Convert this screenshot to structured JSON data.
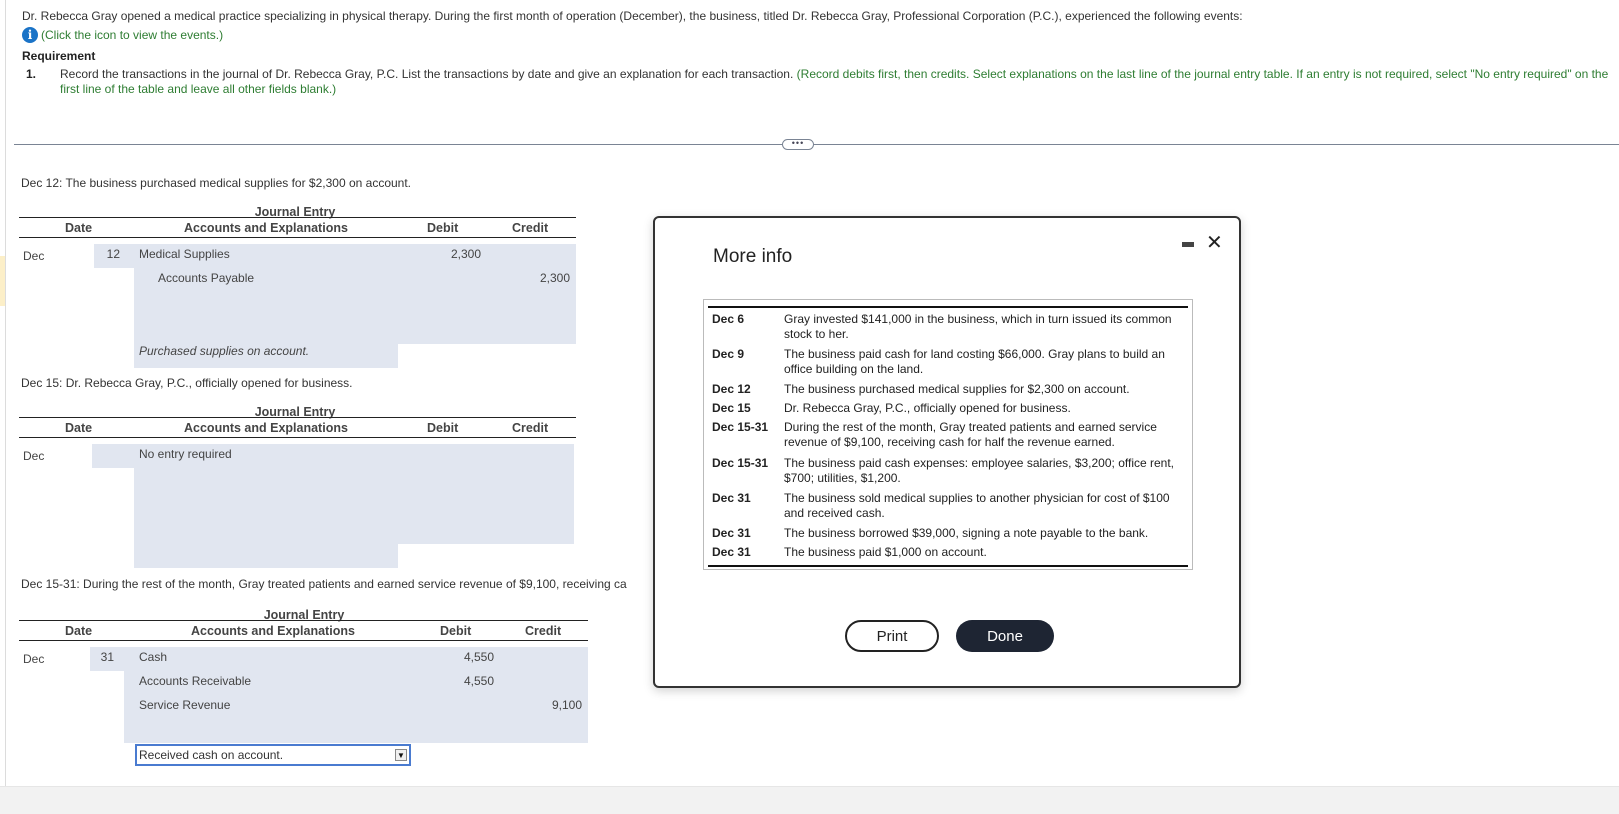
{
  "intro": {
    "text": "Dr. Rebecca Gray opened a medical practice specializing in physical therapy. During the first month of operation (December), the business, titled Dr. Rebecca Gray, Professional Corporation (P.C.), experienced the following events:",
    "hint": "(Click the icon to view the events.)",
    "info_icon": "info-icon"
  },
  "requirement": {
    "title": "Requirement",
    "number": "1.",
    "text": "Record the transactions in the journal of Dr. Rebecca Gray, P.C. List the transactions by date and give an explanation for each transaction.",
    "instruction": "(Record debits first, then credits. Select explanations on the last line of the journal entry table. If an entry is not required, select \"No entry required\" on the first line of the table and leave all other fields blank.)"
  },
  "expander_label": "•••",
  "journal_headers": {
    "title": "Journal Entry",
    "date": "Date",
    "accounts": "Accounts and Explanations",
    "debit": "Debit",
    "credit": "Credit"
  },
  "entries": [
    {
      "prompt": "Dec 12: The business purchased medical supplies for $2,300 on account.",
      "month": "Dec",
      "day": "12",
      "lines": [
        {
          "account": "Medical Supplies",
          "debit": "2,300",
          "credit": ""
        },
        {
          "account": "Accounts Payable",
          "debit": "",
          "credit": "2,300"
        }
      ],
      "explanation": "Purchased supplies on account."
    },
    {
      "prompt": "Dec 15: Dr. Rebecca Gray, P.C., officially opened for business.",
      "month": "Dec",
      "day": "",
      "lines": [
        {
          "account": "No entry required",
          "debit": "",
          "credit": ""
        }
      ],
      "explanation": ""
    },
    {
      "prompt": "Dec 15-31: During the rest of the month, Gray treated patients and earned service revenue of $9,100, receiving ca",
      "month": "Dec",
      "day": "31",
      "lines": [
        {
          "account": "Cash",
          "debit": "4,550",
          "credit": ""
        },
        {
          "account": "Accounts Receivable",
          "debit": "4,550",
          "credit": ""
        },
        {
          "account": "Service Revenue",
          "debit": "",
          "credit": "9,100"
        }
      ],
      "explanation": "Received cash on account."
    }
  ],
  "modal": {
    "title": "More info",
    "print_label": "Print",
    "done_label": "Done",
    "events": [
      {
        "date": "Dec 6",
        "text": "Gray invested $141,000 in the business, which in turn issued its common stock to her."
      },
      {
        "date": "Dec 9",
        "text": "The business paid cash for land costing $66,000. Gray plans to build an office building on the land."
      },
      {
        "date": "Dec 12",
        "text": "The business purchased medical supplies for $2,300 on account."
      },
      {
        "date": "Dec 15",
        "text": "Dr. Rebecca Gray, P.C., officially opened for business."
      },
      {
        "date": "Dec 15-31",
        "text": "During the rest of the month, Gray treated patients and earned service revenue of $9,100, receiving cash for half the revenue earned."
      },
      {
        "date": "Dec 15-31",
        "text": "The business paid cash expenses: employee salaries, $3,200; office rent, $700; utilities, $1,200."
      },
      {
        "date": "Dec 31",
        "text": "The business sold medical supplies to another physician for cost of $100 and received cash."
      },
      {
        "date": "Dec 31",
        "text": "The business borrowed $39,000, signing a note payable to the bank."
      },
      {
        "date": "Dec 31",
        "text": "The business paid $1,000 on account."
      }
    ]
  }
}
